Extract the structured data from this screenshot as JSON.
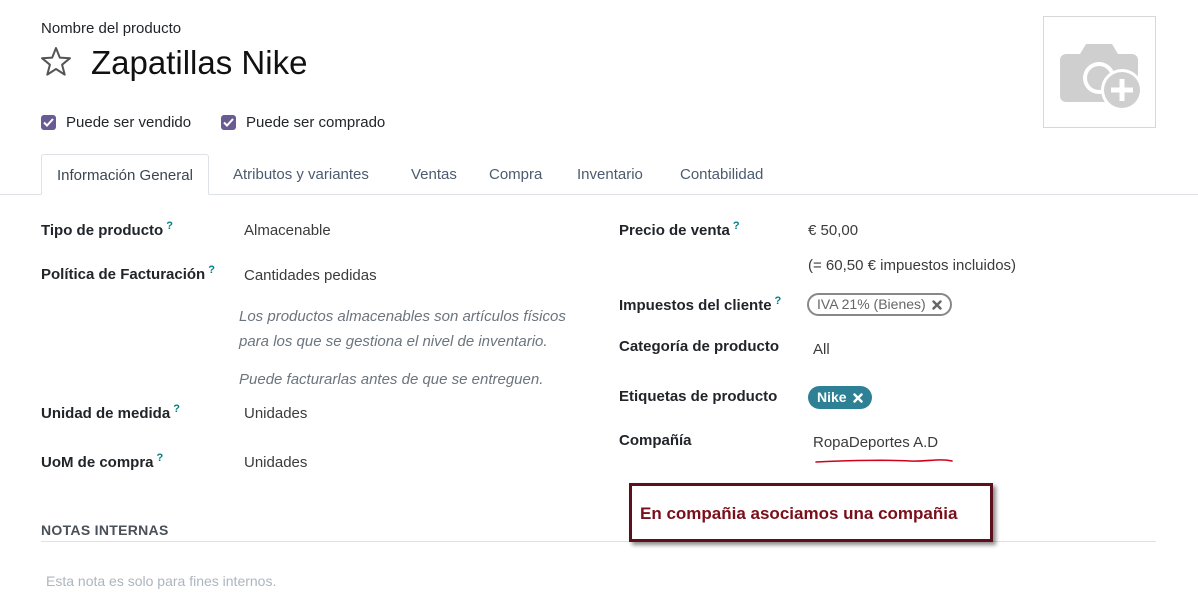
{
  "header": {
    "field_label": "Nombre del producto",
    "product_name": "Zapatillas Nike",
    "favorite_icon": "star-icon",
    "photo_icon": "camera-plus-icon"
  },
  "checkboxes": [
    {
      "label": "Puede ser vendido",
      "checked": true
    },
    {
      "label": "Puede ser comprado",
      "checked": true
    }
  ],
  "tabs": [
    {
      "label": "Información General",
      "active": true
    },
    {
      "label": "Atributos y variantes",
      "active": false
    },
    {
      "label": "Ventas",
      "active": false
    },
    {
      "label": "Compra",
      "active": false
    },
    {
      "label": "Inventario",
      "active": false
    },
    {
      "label": "Contabilidad",
      "active": false
    }
  ],
  "left_fields": {
    "tipo_producto": {
      "label": "Tipo de producto",
      "help": "?",
      "value": "Almacenable"
    },
    "politica_facturacion": {
      "label": "Política de Facturación",
      "help": "?",
      "value": "Cantidades pedidas"
    },
    "hint_line1": "Los productos almacenables son artículos físicos",
    "hint_line2": "para los que se gestiona el nivel de inventario.",
    "hint_line3": "Puede facturarlas antes de que se entreguen.",
    "unidad_medida": {
      "label": "Unidad de medida",
      "help": "?",
      "value": "Unidades"
    },
    "uom_compra": {
      "label": "UoM de compra",
      "help": "?",
      "value": "Unidades"
    }
  },
  "right_fields": {
    "precio_venta": {
      "label": "Precio de venta",
      "help": "?",
      "value": "€ 50,00",
      "tax_included": "(= 60,50 € impuestos incluidos)"
    },
    "impuestos_cliente": {
      "label": "Impuestos del cliente",
      "help": "?",
      "tag": "IVA 21% (Bienes)"
    },
    "categoria": {
      "label": "Categoría de producto",
      "value": "All"
    },
    "etiquetas": {
      "label": "Etiquetas de producto",
      "tag": "Nike"
    },
    "compania": {
      "label": "Compañía",
      "value": "RopaDeportes A.D"
    }
  },
  "notes": {
    "title": "NOTAS INTERNAS",
    "placeholder": "Esta nota es solo para fines internos."
  },
  "annotation": {
    "text": "En compañia asociamos una compañia"
  },
  "colors": {
    "checkbox": "#6b5b95",
    "help_mark": "#017e84",
    "tag_nike": "#2e8095",
    "annotation_border": "#5e0f1c",
    "annotation_text": "#7a0e1a",
    "underline": "#d0021b"
  }
}
